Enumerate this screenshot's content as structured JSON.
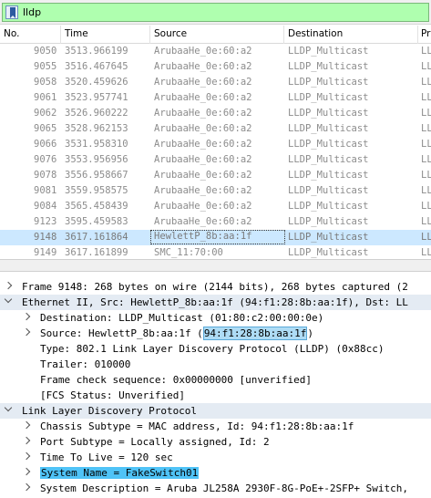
{
  "filter": {
    "text": "lldp",
    "status_color": "#afffaf"
  },
  "columns": [
    "No.",
    "Time",
    "Source",
    "Destination",
    "Pr"
  ],
  "packets": [
    {
      "no": "9050",
      "time": "3513.966199",
      "src": "ArubaaHe_0e:60:a2",
      "dst": "LLDP_Multicast",
      "proto": "LL"
    },
    {
      "no": "9055",
      "time": "3516.467645",
      "src": "ArubaaHe_0e:60:a2",
      "dst": "LLDP_Multicast",
      "proto": "LL"
    },
    {
      "no": "9058",
      "time": "3520.459626",
      "src": "ArubaaHe_0e:60:a2",
      "dst": "LLDP_Multicast",
      "proto": "LL"
    },
    {
      "no": "9061",
      "time": "3523.957741",
      "src": "ArubaaHe_0e:60:a2",
      "dst": "LLDP_Multicast",
      "proto": "LL"
    },
    {
      "no": "9062",
      "time": "3526.960222",
      "src": "ArubaaHe_0e:60:a2",
      "dst": "LLDP_Multicast",
      "proto": "LL"
    },
    {
      "no": "9065",
      "time": "3528.962153",
      "src": "ArubaaHe_0e:60:a2",
      "dst": "LLDP_Multicast",
      "proto": "LL"
    },
    {
      "no": "9066",
      "time": "3531.958310",
      "src": "ArubaaHe_0e:60:a2",
      "dst": "LLDP_Multicast",
      "proto": "LL"
    },
    {
      "no": "9076",
      "time": "3553.956956",
      "src": "ArubaaHe_0e:60:a2",
      "dst": "LLDP_Multicast",
      "proto": "LL"
    },
    {
      "no": "9078",
      "time": "3556.958667",
      "src": "ArubaaHe_0e:60:a2",
      "dst": "LLDP_Multicast",
      "proto": "LL"
    },
    {
      "no": "9081",
      "time": "3559.958575",
      "src": "ArubaaHe_0e:60:a2",
      "dst": "LLDP_Multicast",
      "proto": "LL"
    },
    {
      "no": "9084",
      "time": "3565.458439",
      "src": "ArubaaHe_0e:60:a2",
      "dst": "LLDP_Multicast",
      "proto": "LL"
    },
    {
      "no": "9123",
      "time": "3595.459583",
      "src": "ArubaaHe_0e:60:a2",
      "dst": "LLDP_Multicast",
      "proto": "LL"
    },
    {
      "no": "9148",
      "time": "3617.161864",
      "src": "HewlettP_8b:aa:1f",
      "dst": "LLDP_Multicast",
      "proto": "LL"
    },
    {
      "no": "9149",
      "time": "3617.161899",
      "src": "SMC_11:70:00",
      "dst": "LLDP_Multicast",
      "proto": "LL"
    }
  ],
  "selected_packet": "9148",
  "details": {
    "frame": "Frame 9148: 268 bytes on wire (2144 bits), 268 bytes captured (2",
    "ethernet": "Ethernet II, Src: HewlettP_8b:aa:1f (94:f1:28:8b:aa:1f), Dst: LL",
    "eth_dst": "Destination: LLDP_Multicast (01:80:c2:00:00:0e)",
    "eth_src_prefix": "Source: HewlettP_8b:aa:1f (",
    "eth_src_mac": "94:f1:28:8b:aa:1f",
    "eth_src_suffix": ")",
    "eth_type": "Type: 802.1 Link Layer Discovery Protocol (LLDP) (0x88cc)",
    "eth_trailer": "Trailer: 010000",
    "eth_fcs": "Frame check sequence: 0x00000000 [unverified]",
    "eth_fcs_status": "[FCS Status: Unverified]",
    "lldp": "Link Layer Discovery Protocol",
    "chassis": "Chassis Subtype = MAC address, Id: 94:f1:28:8b:aa:1f",
    "port": "Port Subtype = Locally assigned, Id: 2",
    "ttl": "Time To Live = 120 sec",
    "sysname": "System Name = FakeSwitch01",
    "sysdesc": "System Description = Aruba JL258A 2930F-8G-PoE+-2SFP+ Switch,"
  }
}
